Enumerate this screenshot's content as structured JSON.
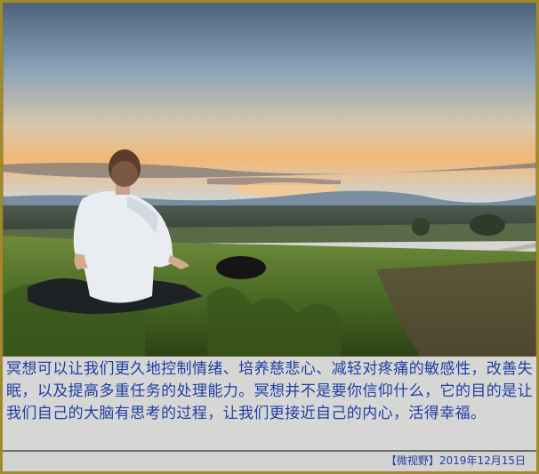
{
  "caption": "冥想可以让我们更久地控制情绪、培养慈悲心、减轻对疼痛的敏感性，改善失眠，以及提高多重任务的处理能力。冥想并不是要你信仰什么，它的目的是让我们自己的大脑有思考的过程，让我们更接近自己的内心，活得幸福。",
  "footer": {
    "credit": "【微视野】2019年12月15日"
  },
  "colors": {
    "frame": "#a08a2a",
    "text": "#1f3fa6",
    "panel": "#d6d6d4"
  }
}
